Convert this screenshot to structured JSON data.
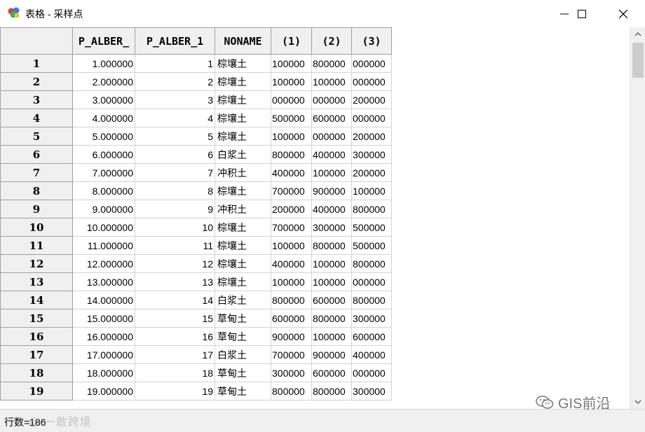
{
  "window": {
    "title": "表格 - 采样点"
  },
  "table": {
    "columns": [
      "P_ALBER_",
      "P_ALBER_1",
      "NONAME",
      "(1)",
      "(2)",
      "(3)"
    ],
    "rows": [
      {
        "n": "1",
        "c1": "1.000000",
        "c2": "1",
        "c3": "棕壤土",
        "c4": "100000",
        "c5": "800000",
        "c6": "000000"
      },
      {
        "n": "2",
        "c1": "2.000000",
        "c2": "2",
        "c3": "棕壤土",
        "c4": "100000",
        "c5": "100000",
        "c6": "000000"
      },
      {
        "n": "3",
        "c1": "3.000000",
        "c2": "3",
        "c3": "棕壤土",
        "c4": "000000",
        "c5": "000000",
        "c6": "200000"
      },
      {
        "n": "4",
        "c1": "4.000000",
        "c2": "4",
        "c3": "棕壤土",
        "c4": "500000",
        "c5": "600000",
        "c6": "000000"
      },
      {
        "n": "5",
        "c1": "5.000000",
        "c2": "5",
        "c3": "棕壤土",
        "c4": "100000",
        "c5": "000000",
        "c6": "200000"
      },
      {
        "n": "6",
        "c1": "6.000000",
        "c2": "6",
        "c3": "白浆土",
        "c4": "800000",
        "c5": "400000",
        "c6": "300000"
      },
      {
        "n": "7",
        "c1": "7.000000",
        "c2": "7",
        "c3": "冲积土",
        "c4": "400000",
        "c5": "100000",
        "c6": "200000"
      },
      {
        "n": "8",
        "c1": "8.000000",
        "c2": "8",
        "c3": "棕壤土",
        "c4": "700000",
        "c5": "900000",
        "c6": "100000"
      },
      {
        "n": "9",
        "c1": "9.000000",
        "c2": "9",
        "c3": "冲积土",
        "c4": "200000",
        "c5": "400000",
        "c6": "800000"
      },
      {
        "n": "10",
        "c1": "10.000000",
        "c2": "10",
        "c3": "棕壤土",
        "c4": "700000",
        "c5": "300000",
        "c6": "500000"
      },
      {
        "n": "11",
        "c1": "11.000000",
        "c2": "11",
        "c3": "棕壤土",
        "c4": "100000",
        "c5": "800000",
        "c6": "500000"
      },
      {
        "n": "12",
        "c1": "12.000000",
        "c2": "12",
        "c3": "棕壤土",
        "c4": "400000",
        "c5": "100000",
        "c6": "800000"
      },
      {
        "n": "13",
        "c1": "13.000000",
        "c2": "13",
        "c3": "棕壤土",
        "c4": "100000",
        "c5": "100000",
        "c6": "000000"
      },
      {
        "n": "14",
        "c1": "14.000000",
        "c2": "14",
        "c3": "白浆土",
        "c4": "800000",
        "c5": "600000",
        "c6": "800000"
      },
      {
        "n": "15",
        "c1": "15.000000",
        "c2": "15",
        "c3": "草甸土",
        "c4": "600000",
        "c5": "800000",
        "c6": "300000"
      },
      {
        "n": "16",
        "c1": "16.000000",
        "c2": "16",
        "c3": "草甸土",
        "c4": "900000",
        "c5": "100000",
        "c6": "600000"
      },
      {
        "n": "17",
        "c1": "17.000000",
        "c2": "17",
        "c3": "白浆土",
        "c4": "700000",
        "c5": "900000",
        "c6": "400000"
      },
      {
        "n": "18",
        "c1": "18.000000",
        "c2": "18",
        "c3": "草甸土",
        "c4": "300000",
        "c5": "600000",
        "c6": "000000"
      },
      {
        "n": "19",
        "c1": "19.000000",
        "c2": "19",
        "c3": "草甸土",
        "c4": "800000",
        "c5": "800000",
        "c6": "300000"
      }
    ]
  },
  "status": {
    "row_count": "行数=186"
  },
  "watermark": {
    "left": "@ 一敢跨境",
    "right": "GIS前沿"
  },
  "icons": {
    "app": "colorful-layers-icon",
    "minimize": "minimize-icon",
    "maximize": "maximize-icon",
    "close": "close-icon",
    "scroll_up": "chevron-up-icon",
    "scroll_down": "chevron-down-icon",
    "wechat": "wechat-icon"
  }
}
